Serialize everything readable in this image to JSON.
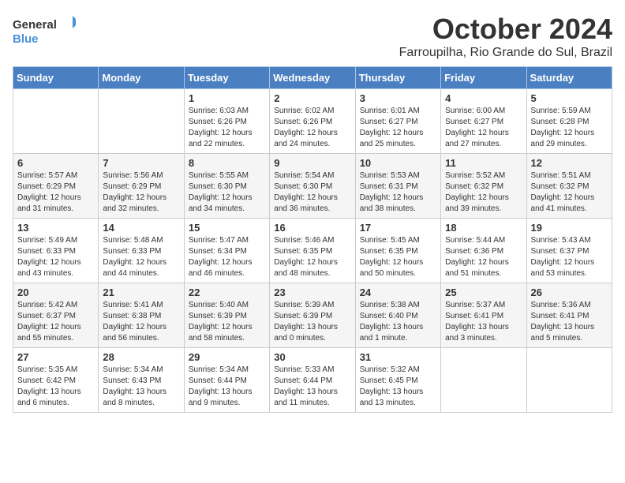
{
  "header": {
    "logo": {
      "general": "General",
      "blue": "Blue"
    },
    "title": "October 2024",
    "location": "Farroupilha, Rio Grande do Sul, Brazil"
  },
  "days_of_week": [
    "Sunday",
    "Monday",
    "Tuesday",
    "Wednesday",
    "Thursday",
    "Friday",
    "Saturday"
  ],
  "weeks": [
    [
      {
        "day": null,
        "info": null
      },
      {
        "day": null,
        "info": null
      },
      {
        "day": "1",
        "info": "Sunrise: 6:03 AM\nSunset: 6:26 PM\nDaylight: 12 hours and 22 minutes."
      },
      {
        "day": "2",
        "info": "Sunrise: 6:02 AM\nSunset: 6:26 PM\nDaylight: 12 hours and 24 minutes."
      },
      {
        "day": "3",
        "info": "Sunrise: 6:01 AM\nSunset: 6:27 PM\nDaylight: 12 hours and 25 minutes."
      },
      {
        "day": "4",
        "info": "Sunrise: 6:00 AM\nSunset: 6:27 PM\nDaylight: 12 hours and 27 minutes."
      },
      {
        "day": "5",
        "info": "Sunrise: 5:59 AM\nSunset: 6:28 PM\nDaylight: 12 hours and 29 minutes."
      }
    ],
    [
      {
        "day": "6",
        "info": "Sunrise: 5:57 AM\nSunset: 6:29 PM\nDaylight: 12 hours and 31 minutes."
      },
      {
        "day": "7",
        "info": "Sunrise: 5:56 AM\nSunset: 6:29 PM\nDaylight: 12 hours and 32 minutes."
      },
      {
        "day": "8",
        "info": "Sunrise: 5:55 AM\nSunset: 6:30 PM\nDaylight: 12 hours and 34 minutes."
      },
      {
        "day": "9",
        "info": "Sunrise: 5:54 AM\nSunset: 6:30 PM\nDaylight: 12 hours and 36 minutes."
      },
      {
        "day": "10",
        "info": "Sunrise: 5:53 AM\nSunset: 6:31 PM\nDaylight: 12 hours and 38 minutes."
      },
      {
        "day": "11",
        "info": "Sunrise: 5:52 AM\nSunset: 6:32 PM\nDaylight: 12 hours and 39 minutes."
      },
      {
        "day": "12",
        "info": "Sunrise: 5:51 AM\nSunset: 6:32 PM\nDaylight: 12 hours and 41 minutes."
      }
    ],
    [
      {
        "day": "13",
        "info": "Sunrise: 5:49 AM\nSunset: 6:33 PM\nDaylight: 12 hours and 43 minutes."
      },
      {
        "day": "14",
        "info": "Sunrise: 5:48 AM\nSunset: 6:33 PM\nDaylight: 12 hours and 44 minutes."
      },
      {
        "day": "15",
        "info": "Sunrise: 5:47 AM\nSunset: 6:34 PM\nDaylight: 12 hours and 46 minutes."
      },
      {
        "day": "16",
        "info": "Sunrise: 5:46 AM\nSunset: 6:35 PM\nDaylight: 12 hours and 48 minutes."
      },
      {
        "day": "17",
        "info": "Sunrise: 5:45 AM\nSunset: 6:35 PM\nDaylight: 12 hours and 50 minutes."
      },
      {
        "day": "18",
        "info": "Sunrise: 5:44 AM\nSunset: 6:36 PM\nDaylight: 12 hours and 51 minutes."
      },
      {
        "day": "19",
        "info": "Sunrise: 5:43 AM\nSunset: 6:37 PM\nDaylight: 12 hours and 53 minutes."
      }
    ],
    [
      {
        "day": "20",
        "info": "Sunrise: 5:42 AM\nSunset: 6:37 PM\nDaylight: 12 hours and 55 minutes."
      },
      {
        "day": "21",
        "info": "Sunrise: 5:41 AM\nSunset: 6:38 PM\nDaylight: 12 hours and 56 minutes."
      },
      {
        "day": "22",
        "info": "Sunrise: 5:40 AM\nSunset: 6:39 PM\nDaylight: 12 hours and 58 minutes."
      },
      {
        "day": "23",
        "info": "Sunrise: 5:39 AM\nSunset: 6:39 PM\nDaylight: 13 hours and 0 minutes."
      },
      {
        "day": "24",
        "info": "Sunrise: 5:38 AM\nSunset: 6:40 PM\nDaylight: 13 hours and 1 minute."
      },
      {
        "day": "25",
        "info": "Sunrise: 5:37 AM\nSunset: 6:41 PM\nDaylight: 13 hours and 3 minutes."
      },
      {
        "day": "26",
        "info": "Sunrise: 5:36 AM\nSunset: 6:41 PM\nDaylight: 13 hours and 5 minutes."
      }
    ],
    [
      {
        "day": "27",
        "info": "Sunrise: 5:35 AM\nSunset: 6:42 PM\nDaylight: 13 hours and 6 minutes."
      },
      {
        "day": "28",
        "info": "Sunrise: 5:34 AM\nSunset: 6:43 PM\nDaylight: 13 hours and 8 minutes."
      },
      {
        "day": "29",
        "info": "Sunrise: 5:34 AM\nSunset: 6:44 PM\nDaylight: 13 hours and 9 minutes."
      },
      {
        "day": "30",
        "info": "Sunrise: 5:33 AM\nSunset: 6:44 PM\nDaylight: 13 hours and 11 minutes."
      },
      {
        "day": "31",
        "info": "Sunrise: 5:32 AM\nSunset: 6:45 PM\nDaylight: 13 hours and 13 minutes."
      },
      {
        "day": null,
        "info": null
      },
      {
        "day": null,
        "info": null
      }
    ]
  ]
}
